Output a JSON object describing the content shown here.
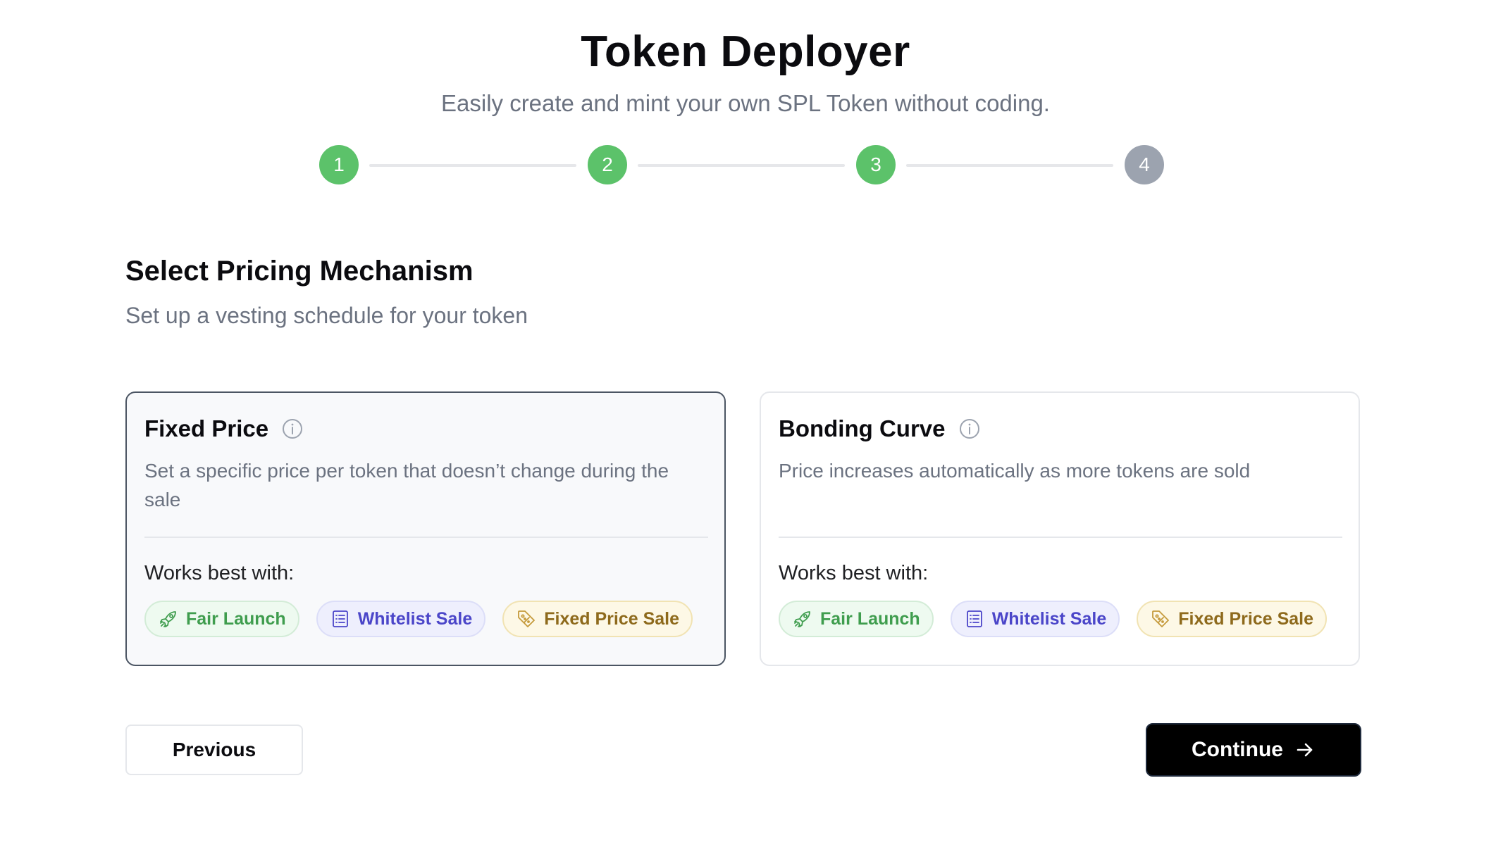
{
  "header": {
    "title": "Token Deployer",
    "subtitle": "Easily create and mint your own SPL Token without coding."
  },
  "stepper": {
    "current_step": 4,
    "steps": [
      {
        "label": "1",
        "status": "completed"
      },
      {
        "label": "2",
        "status": "completed"
      },
      {
        "label": "3",
        "status": "completed"
      },
      {
        "label": "4",
        "status": "upcoming"
      }
    ],
    "colors": {
      "completed": "#5cc26a",
      "upcoming": "#9ca3af"
    }
  },
  "section": {
    "title": "Select Pricing Mechanism",
    "subtitle": "Set up a vesting schedule for your token"
  },
  "options": [
    {
      "title": "Fixed Price",
      "description": "Set a specific price per token that doesn’t change during the sale",
      "selected": true,
      "works_best_label": "Works best with:",
      "tags": [
        {
          "label": "Fair Launch",
          "icon": "rocket-icon"
        },
        {
          "label": "Whitelist Sale",
          "icon": "list-icon"
        },
        {
          "label": "Fixed Price Sale",
          "icon": "price-tag-icon"
        }
      ]
    },
    {
      "title": "Bonding Curve",
      "description": "Price increases automatically as more tokens are sold",
      "selected": false,
      "works_best_label": "Works best with:",
      "tags": [
        {
          "label": "Fair Launch",
          "icon": "rocket-icon"
        },
        {
          "label": "Whitelist Sale",
          "icon": "list-icon"
        },
        {
          "label": "Fixed Price Sale",
          "icon": "price-tag-icon"
        }
      ]
    }
  ],
  "actions": {
    "previous_label": "Previous",
    "continue_label": "Continue",
    "continue_icon": "arrow-right-icon"
  },
  "colors": {
    "accent_dark": "#000000",
    "fair_launch": "#3f9d4e",
    "whitelist": "#4b46c9",
    "fixed_price_sale": "#8e6a1c"
  }
}
